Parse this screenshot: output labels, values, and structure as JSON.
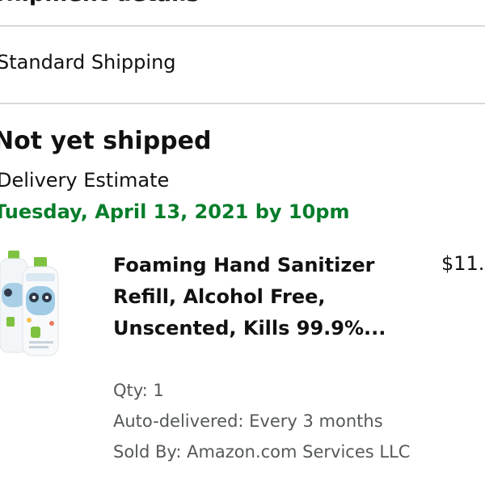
{
  "section": {
    "title": "Shipment details"
  },
  "shipping": {
    "method": "Standard Shipping"
  },
  "shipment": {
    "status": "Not yet shipped",
    "delivery_label": "Delivery Estimate",
    "delivery_date": "Tuesday, April 13, 2021 by 10pm"
  },
  "item": {
    "image_icon": "product-bottles-image",
    "title": "Foaming Hand Sanitizer Refill, Alcohol Free, Unscented, Kills 99.9%...",
    "price": "$11.",
    "qty": "Qty: 1",
    "auto_delivery": "Auto-delivered: Every 3 months",
    "sold_by": "Sold By: Amazon.com Services LLC"
  },
  "colors": {
    "delivery_green": "#067d2a",
    "secondary_text": "#565959",
    "divider": "#d5d9d9"
  }
}
